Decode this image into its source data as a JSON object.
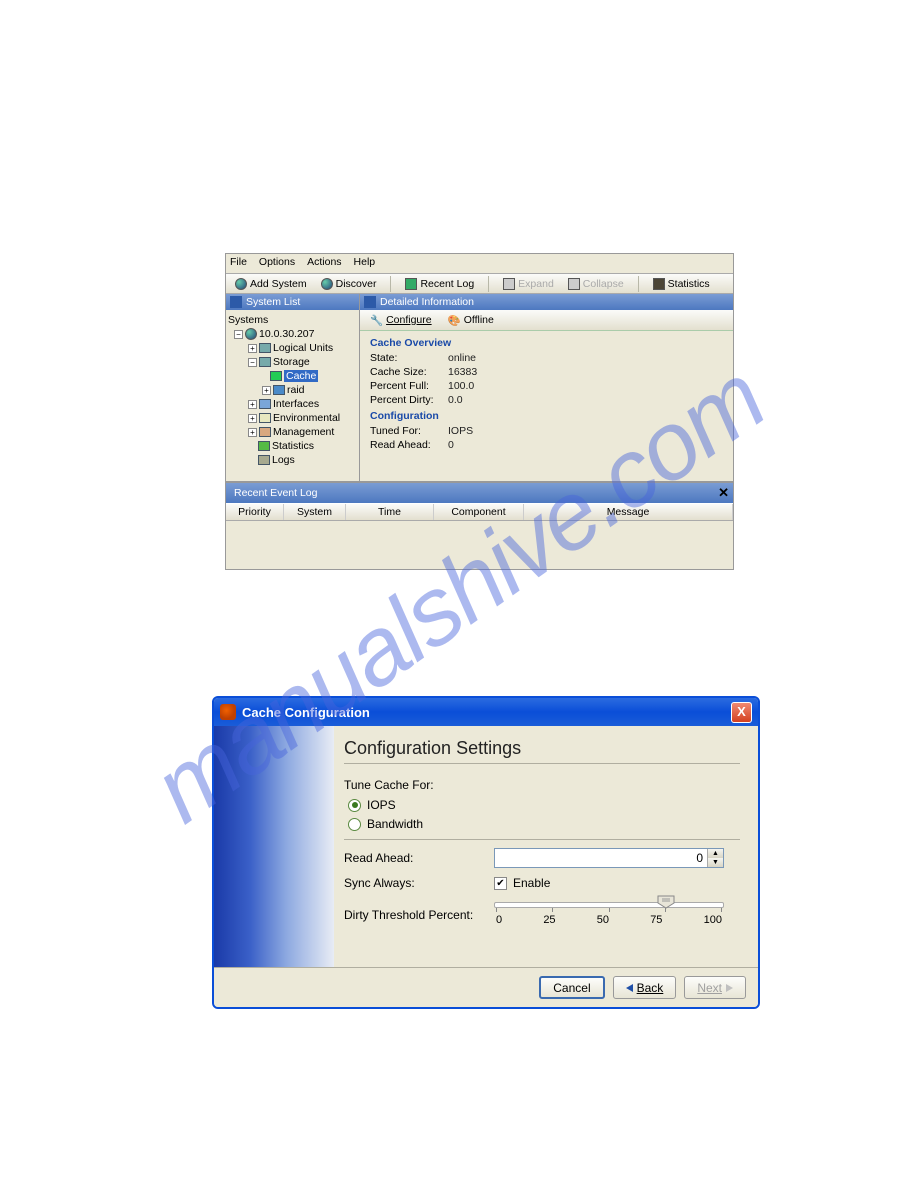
{
  "watermark": "manualshive.com",
  "app1": {
    "menus": {
      "file": "File",
      "options": "Options",
      "actions": "Actions",
      "help": "Help"
    },
    "toolbar": {
      "add": "Add System",
      "discover": "Discover",
      "recent": "Recent Log",
      "expand": "Expand",
      "collapse": "Collapse",
      "statistics": "Statistics"
    },
    "sidebar": {
      "title": "System List",
      "root": "Systems",
      "ip": "10.0.30.207",
      "items": {
        "logical": "Logical Units",
        "storage": "Storage",
        "cache": "Cache",
        "raid": "raid",
        "interfaces": "Interfaces",
        "environmental": "Environmental",
        "management": "Management",
        "statistics": "Statistics",
        "logs": "Logs"
      }
    },
    "detail": {
      "title": "Detailed Information",
      "configure": "Configure",
      "offline": "Offline",
      "section1": "Cache Overview",
      "state_k": "State:",
      "state_v": "online",
      "size_k": "Cache Size:",
      "size_v": "16383",
      "pfull_k": "Percent Full:",
      "pfull_v": "100.0",
      "pdirty_k": "Percent Dirty:",
      "pdirty_v": "0.0",
      "section2": "Configuration",
      "tuned_k": "Tuned For:",
      "tuned_v": "IOPS",
      "ra_k": "Read Ahead:",
      "ra_v": "0"
    },
    "eventlog": {
      "title": "Recent Event Log",
      "cols": {
        "priority": "Priority",
        "system": "System",
        "time": "Time",
        "component": "Component",
        "message": "Message"
      }
    }
  },
  "app2": {
    "title": "Cache Configuration",
    "heading": "Configuration Settings",
    "tune_label": "Tune Cache For:",
    "opt_iops": "IOPS",
    "opt_bw": "Bandwidth",
    "read_ahead_label": "Read Ahead:",
    "read_ahead_value": "0",
    "sync_label": "Sync Always:",
    "sync_enable": "Enable",
    "dirty_label": "Dirty Threshold Percent:",
    "ticks": {
      "t0": "0",
      "t25": "25",
      "t50": "50",
      "t75": "75",
      "t100": "100"
    },
    "buttons": {
      "cancel": "Cancel",
      "back": "Back",
      "next": "Next"
    }
  }
}
